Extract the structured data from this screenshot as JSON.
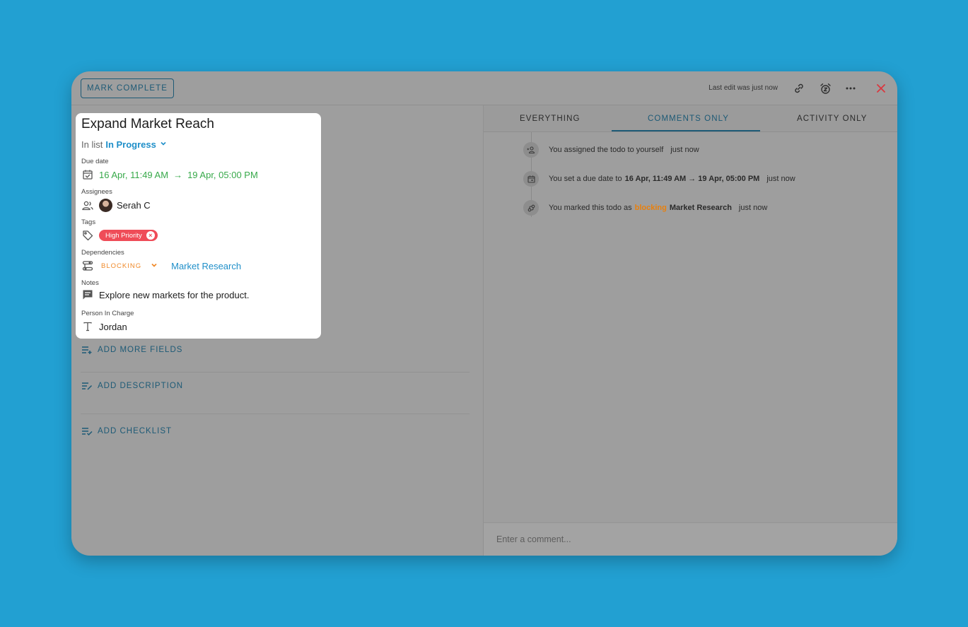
{
  "toolbar": {
    "mark_complete": "MARK COMPLETE",
    "last_edit": "Last edit was just now",
    "icons": [
      "link-icon",
      "alarm-icon",
      "more-icon",
      "close-icon"
    ],
    "close_color": "#d9383f"
  },
  "task": {
    "title": "Expand Market Reach",
    "in_list_prefix": "In list",
    "list_name": "In Progress",
    "fields": {
      "due_date": {
        "label": "Due date",
        "start": "16 Apr, 11:49 AM",
        "arrow": "→",
        "end": "19 Apr, 05:00 PM"
      },
      "assignees": {
        "label": "Assignees",
        "name": "Serah C"
      },
      "tags": {
        "label": "Tags",
        "items": [
          {
            "name": "High Priority",
            "color": "#ef4c58"
          }
        ]
      },
      "dependencies": {
        "label": "Dependencies",
        "type": "BLOCKING",
        "target": "Market Research"
      },
      "notes": {
        "label": "Notes",
        "value": "Explore new markets for the product."
      },
      "person_in_charge": {
        "label": "Person In Charge",
        "value": "Jordan"
      }
    }
  },
  "actions": {
    "add_more_fields": "ADD MORE FIELDS",
    "add_description": "ADD DESCRIPTION",
    "add_checklist": "ADD CHECKLIST"
  },
  "tabs": [
    {
      "label": "EVERYTHING",
      "active": false
    },
    {
      "label": "COMMENTS ONLY",
      "active": true
    },
    {
      "label": "ACTIVITY ONLY",
      "active": false
    }
  ],
  "activity": [
    {
      "icon": "assign-user-icon",
      "text": "You assigned the todo to yourself",
      "time": "just now"
    },
    {
      "icon": "calendar-icon",
      "text_prefix": "You set a due date to",
      "bold": "16 Apr, 11:49 AM → 19 Apr, 05:00 PM",
      "time": "just now"
    },
    {
      "icon": "dependency-icon",
      "text_prefix": "You marked this todo as",
      "highlight": "blocking",
      "target": "Market Research",
      "time": "just now"
    }
  ],
  "comment": {
    "placeholder": "Enter a comment..."
  },
  "colors": {
    "background": "#22A0D2",
    "accent": "#1f8fc9",
    "due_green": "#37a94a",
    "blocking_orange": "#f08a2a"
  }
}
